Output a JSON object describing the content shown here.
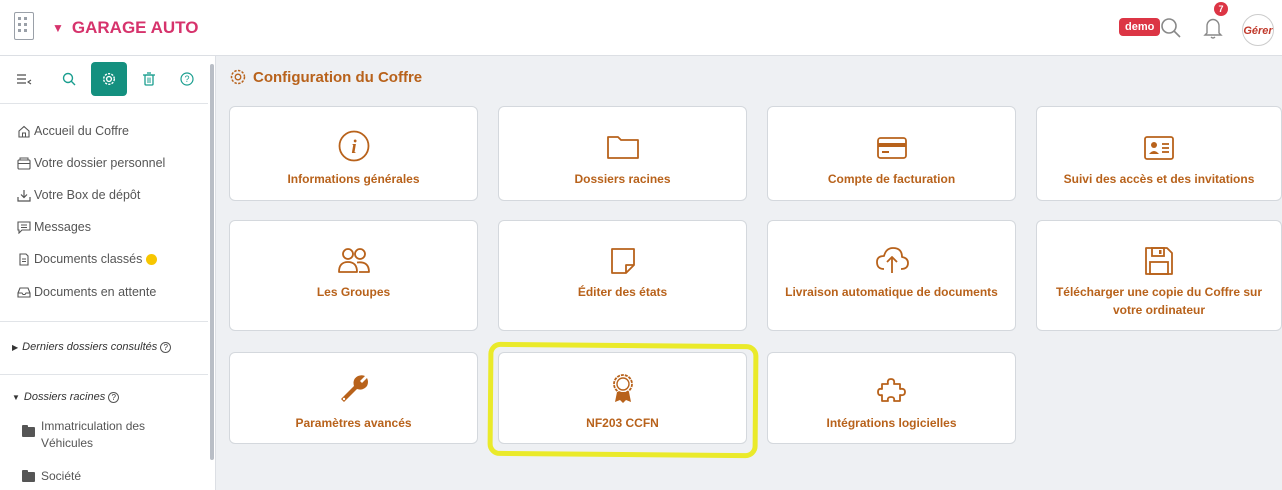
{
  "app": {
    "company_name": "GARAGE AUTO",
    "brand_color": "#d6336c",
    "accent_color": "#b8621b",
    "demo_label": "demo",
    "notification_count": "7",
    "avatar_text": "Gérer"
  },
  "sidebar": {
    "toolbar": [
      {
        "icon": "collapse-menu-icon"
      },
      {
        "icon": "search-icon"
      },
      {
        "icon": "gear-icon",
        "active": true
      },
      {
        "icon": "trash-icon"
      },
      {
        "icon": "help-icon"
      }
    ],
    "nav": [
      {
        "label": "Accueil du Coffre",
        "icon": "home-icon"
      },
      {
        "label": "Votre dossier personnel",
        "icon": "personal-folder-icon"
      },
      {
        "label": "Votre Box de dépôt",
        "icon": "download-icon"
      },
      {
        "label": "Messages",
        "icon": "message-icon"
      },
      {
        "label": "Documents classés",
        "icon": "document-icon"
      },
      {
        "label": "Documents en attente",
        "icon": "inbox-icon"
      }
    ],
    "recent_title": "Derniers dossiers consultés",
    "roots_title": "Dossiers racines",
    "root_folders": [
      {
        "label_line1": "Immatriculation des",
        "label_line2": "Véhicules"
      },
      {
        "label_line1": "Société",
        "label_line2": ""
      }
    ]
  },
  "main": {
    "title": "Configuration du Coffre",
    "cards": [
      {
        "label": "Informations générales",
        "icon": "info-icon"
      },
      {
        "label": "Dossiers racines",
        "icon": "folder-icon"
      },
      {
        "label": "Compte de facturation",
        "icon": "credit-card-icon"
      },
      {
        "label": "Suivi des accès et des invitations",
        "icon": "id-card-icon"
      },
      {
        "label": "Les Groupes",
        "icon": "users-icon"
      },
      {
        "label": "Éditer des états",
        "icon": "sticky-note-icon"
      },
      {
        "label": "Livraison automatique de documents",
        "icon": "cloud-upload-icon"
      },
      {
        "label_line1": "Télécharger une copie du Coffre sur",
        "label_line2": "votre ordinateur",
        "icon": "floppy-disk-icon"
      },
      {
        "label": "Paramètres avancés",
        "icon": "wrench-icon"
      },
      {
        "label": "NF203 CCFN",
        "icon": "award-icon"
      },
      {
        "label": "Intégrations logicielles",
        "icon": "puzzle-icon"
      }
    ]
  }
}
